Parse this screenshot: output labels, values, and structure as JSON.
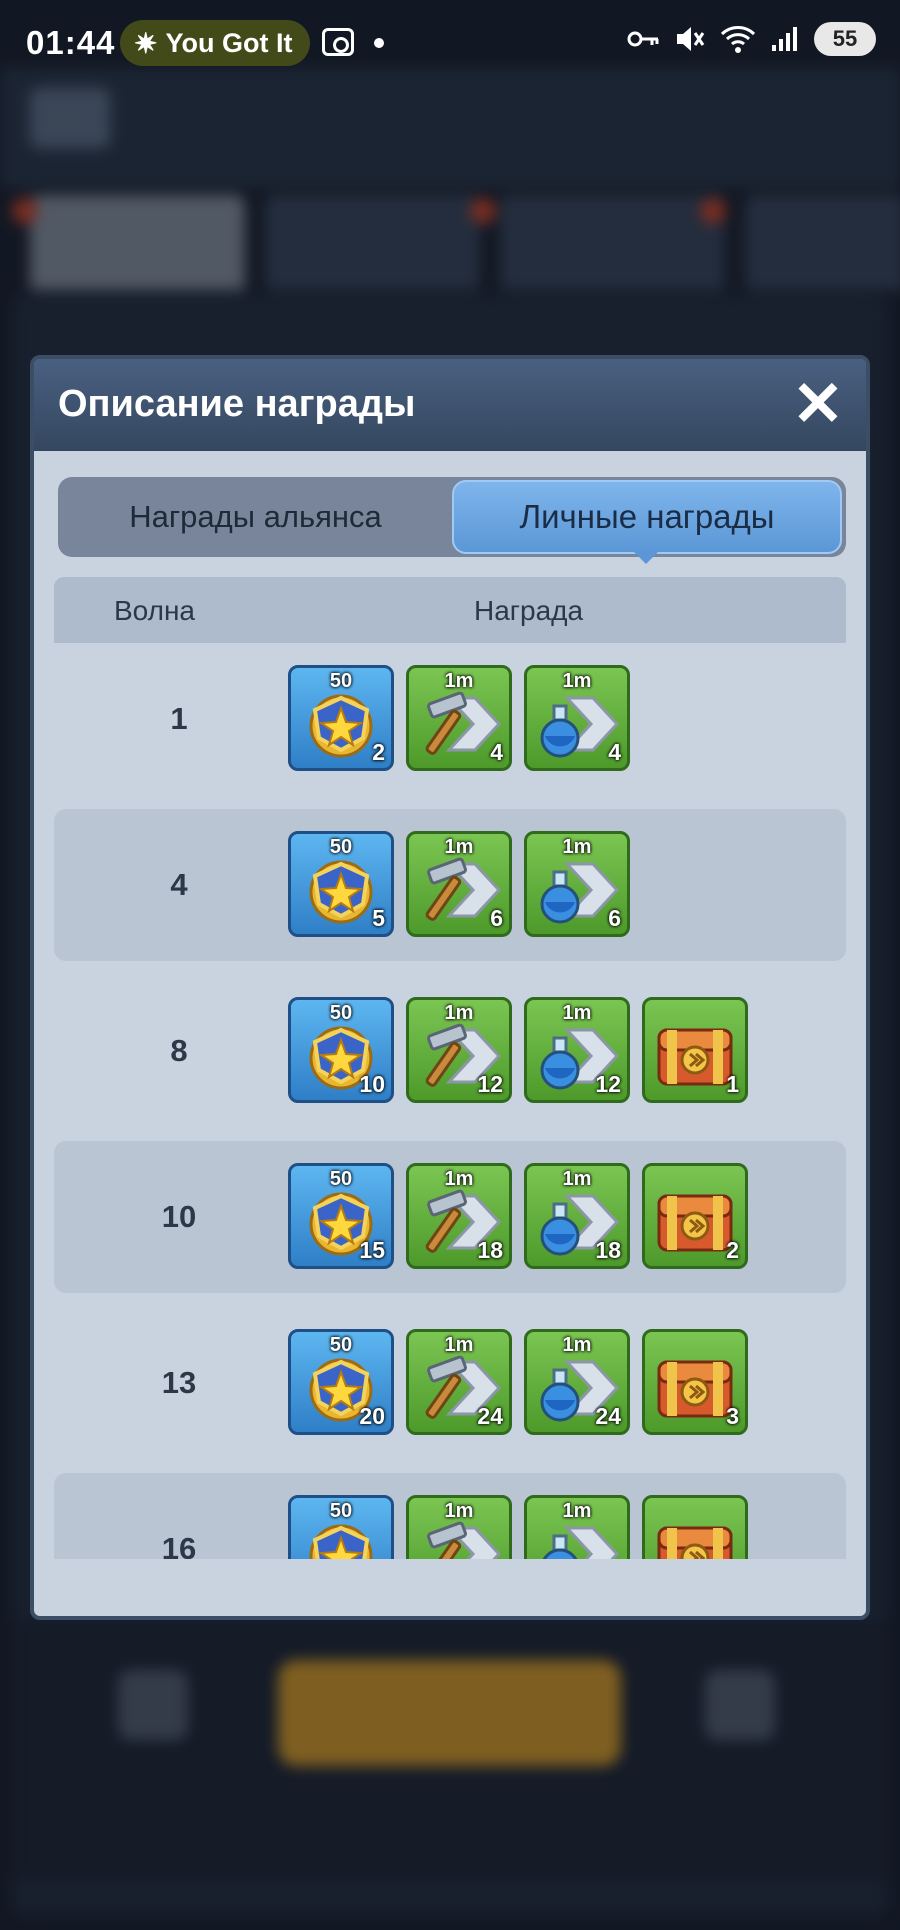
{
  "status_bar": {
    "time": "01:44",
    "notification": "You Got It",
    "battery": "55",
    "icons": [
      "key-icon",
      "mute-icon",
      "wifi-icon",
      "signal-icon",
      "battery-icon"
    ]
  },
  "dialog": {
    "title": "Описание награды",
    "tabs": [
      {
        "label": "Награды альянса",
        "active": false
      },
      {
        "label": "Личные награды",
        "active": true
      }
    ],
    "table": {
      "headers": {
        "wave": "Волна",
        "reward": "Награда"
      },
      "rows": [
        {
          "wave": "1",
          "rewards": [
            {
              "type": "medal",
              "top": "50",
              "count": "2"
            },
            {
              "type": "build-speedup",
              "top": "1m",
              "count": "4"
            },
            {
              "type": "research-speedup",
              "top": "1m",
              "count": "4"
            }
          ]
        },
        {
          "wave": "4",
          "rewards": [
            {
              "type": "medal",
              "top": "50",
              "count": "5"
            },
            {
              "type": "build-speedup",
              "top": "1m",
              "count": "6"
            },
            {
              "type": "research-speedup",
              "top": "1m",
              "count": "6"
            }
          ]
        },
        {
          "wave": "8",
          "rewards": [
            {
              "type": "medal",
              "top": "50",
              "count": "10"
            },
            {
              "type": "build-speedup",
              "top": "1m",
              "count": "12"
            },
            {
              "type": "research-speedup",
              "top": "1m",
              "count": "12"
            },
            {
              "type": "chest",
              "top": "",
              "count": "1"
            }
          ]
        },
        {
          "wave": "10",
          "rewards": [
            {
              "type": "medal",
              "top": "50",
              "count": "15"
            },
            {
              "type": "build-speedup",
              "top": "1m",
              "count": "18"
            },
            {
              "type": "research-speedup",
              "top": "1m",
              "count": "18"
            },
            {
              "type": "chest",
              "top": "",
              "count": "2"
            }
          ]
        },
        {
          "wave": "13",
          "rewards": [
            {
              "type": "medal",
              "top": "50",
              "count": "20"
            },
            {
              "type": "build-speedup",
              "top": "1m",
              "count": "24"
            },
            {
              "type": "research-speedup",
              "top": "1m",
              "count": "24"
            },
            {
              "type": "chest",
              "top": "",
              "count": "3"
            }
          ]
        },
        {
          "wave": "16",
          "rewards": [
            {
              "type": "medal",
              "top": "50",
              "count": ""
            },
            {
              "type": "build-speedup",
              "top": "1m",
              "count": ""
            },
            {
              "type": "research-speedup",
              "top": "1m",
              "count": ""
            },
            {
              "type": "chest",
              "top": "",
              "count": ""
            }
          ]
        }
      ]
    }
  }
}
